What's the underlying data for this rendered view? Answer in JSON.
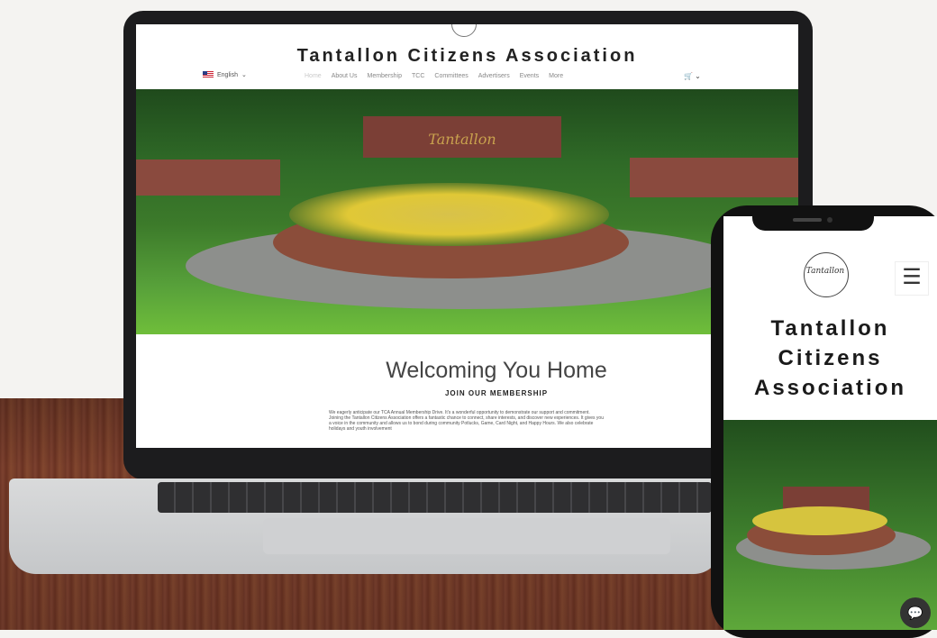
{
  "site": {
    "title": "Tantallon Citizens Association",
    "language": "English",
    "nav": [
      "Home",
      "About Us",
      "Membership",
      "TCC",
      "Committees",
      "Advertisers",
      "Events",
      "More"
    ],
    "hero_sign": "Tantallon",
    "welcome": "Welcoming You Home",
    "join": "JOIN OUR MEMBERSHIP",
    "paragraph": "We eagerly anticipate our TCA Annual Membership Drive. It's a wonderful opportunity to demonstrate our support and commitment. Joining the Tantallon Citizens Association offers a fantastic chance to connect, share interests, and discover new experiences. It gives you a voice in the community and allows us to bond during community Potlucks, Game, Card Night, and Happy Hours. We also celebrate holidays and youth involvement"
  },
  "phone": {
    "logo_text": "Tantallon",
    "title_line1": "Tantallon",
    "title_line2": "Citizens",
    "title_line3": "Association"
  },
  "icons": {
    "menu": "hamburger-icon",
    "chat": "chat-icon",
    "cart": "cart-icon",
    "language_flag": "us-flag-icon"
  }
}
